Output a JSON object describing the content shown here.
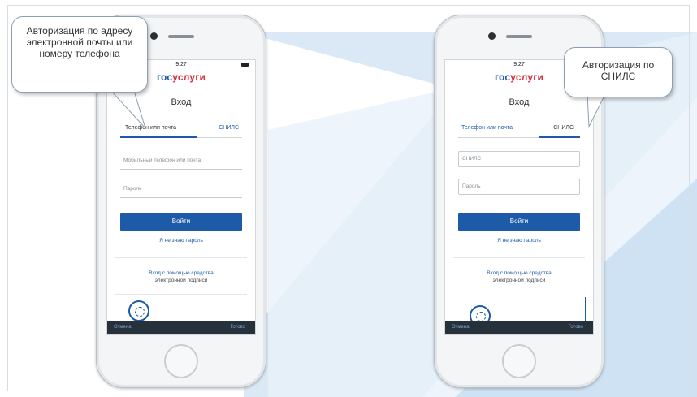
{
  "phones": [
    {
      "status": {
        "time": "9:27"
      },
      "logo": {
        "part1": "гос",
        "part2": "услуги"
      },
      "title": "Вход",
      "tabs": [
        "Телефон или почта",
        "СНИЛС"
      ],
      "active_tab": 0,
      "fields": [
        "Мобильный телефон или почта",
        "Пароль"
      ],
      "login_button": "Войти",
      "forgot_link": "Я не знаю пароль",
      "help": [
        "Вход с помощью средства",
        "электронной подписи"
      ],
      "toolbar": {
        "left": "Отмена",
        "right": "Готово"
      }
    },
    {
      "status": {
        "time": "9:27"
      },
      "logo": {
        "part1": "гос",
        "part2": "услуги"
      },
      "title": "Вход",
      "tabs": [
        "Телефон или почта",
        "СНИЛС"
      ],
      "active_tab": 1,
      "fields": [
        "СНИЛС",
        "Пароль"
      ],
      "login_button": "Войти",
      "forgot_link": "Я не знаю пароль",
      "help": [
        "Вход с помощью средства",
        "электронной подписи"
      ],
      "toolbar": {
        "left": "Отмена",
        "right": "Готово"
      }
    }
  ],
  "callouts": {
    "left": "Авторизация по адресу электронной почты или номеру телефона",
    "right": "Авторизация по СНИЛС"
  },
  "colors": {
    "accent": "#1d5aa7",
    "brand_red": "#d5313a",
    "background_stripe": "#c9dff2"
  }
}
